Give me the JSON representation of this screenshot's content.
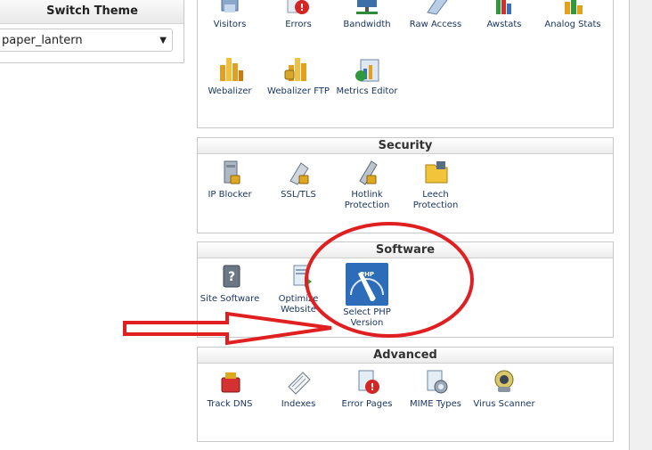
{
  "theme": {
    "title": "Switch Theme",
    "value": "paper_lantern"
  },
  "stats": {
    "row1": [
      {
        "label": "Visitors",
        "icon": "visitors-icon"
      },
      {
        "label": "Errors",
        "icon": "errors-icon"
      },
      {
        "label": "Bandwidth",
        "icon": "bandwidth-icon"
      },
      {
        "label": "Raw Access",
        "icon": "raw-access-icon"
      },
      {
        "label": "Awstats",
        "icon": "awstats-icon"
      },
      {
        "label": "Analog Stats",
        "icon": "analog-stats-icon"
      }
    ],
    "row2": [
      {
        "label": "Webalizer",
        "icon": "webalizer-icon"
      },
      {
        "label": "Webalizer FTP",
        "icon": "webalizer-ftp-icon"
      },
      {
        "label": "Metrics Editor",
        "icon": "metrics-editor-icon"
      }
    ]
  },
  "security": {
    "title": "Security",
    "items": [
      {
        "label": "IP Blocker",
        "icon": "ip-blocker-icon"
      },
      {
        "label": "SSL/TLS",
        "icon": "ssl-tls-icon"
      },
      {
        "label": "Hotlink Protection",
        "line1": "Hotlink",
        "line2": "Protection",
        "icon": "hotlink-protection-icon"
      },
      {
        "label": "Leech Protection",
        "line1": "Leech",
        "line2": "Protection",
        "icon": "leech-protection-icon"
      }
    ]
  },
  "software": {
    "title": "Software",
    "items": [
      {
        "label": "Site Software",
        "icon": "site-software-icon"
      },
      {
        "label": "Optimize Website",
        "line1": "Optimize",
        "line2": "Website",
        "icon": "optimize-website-icon"
      },
      {
        "label": "Select PHP Version",
        "line1": "Select PHP",
        "line2": "Version",
        "badge": "PHP",
        "icon": "php-gauge-icon"
      }
    ]
  },
  "advanced": {
    "title": "Advanced",
    "items": [
      {
        "label": "Track DNS",
        "icon": "track-dns-icon"
      },
      {
        "label": "Indexes",
        "icon": "indexes-icon"
      },
      {
        "label": "Error Pages",
        "icon": "error-pages-icon"
      },
      {
        "label": "MIME Types",
        "icon": "mime-types-icon"
      },
      {
        "label": "Virus Scanner",
        "icon": "virus-scanner-icon"
      }
    ]
  },
  "annotation": {
    "color": "#e02020"
  }
}
